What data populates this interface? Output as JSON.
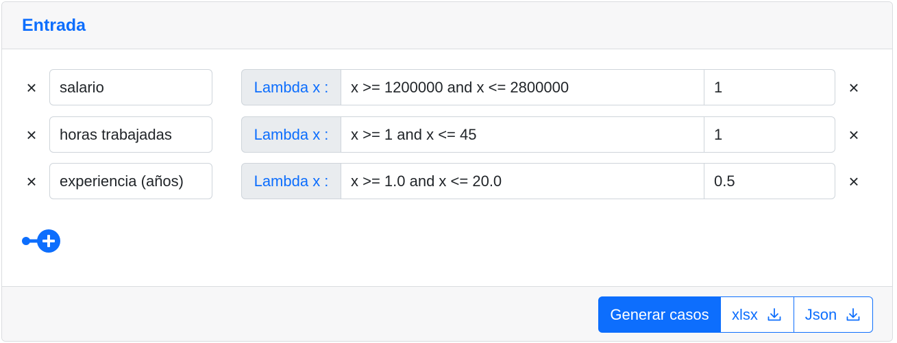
{
  "header": {
    "title": "Entrada"
  },
  "variables": [
    {
      "name": "salario",
      "prefix": "Lambda x :",
      "expression": "x >= 1200000 and x <= 2800000",
      "step": "1"
    },
    {
      "name": "horas trabajadas",
      "prefix": "Lambda x :",
      "expression": "x >= 1 and x <= 45",
      "step": "1"
    },
    {
      "name": "experiencia (años)",
      "prefix": "Lambda x :",
      "expression": "x >= 1.0 and x <= 20.0",
      "step": "0.5"
    }
  ],
  "icons": {
    "remove": "close-icon",
    "add": "add-circle-icon",
    "download": "download-icon"
  },
  "remove_glyph": "×",
  "footer": {
    "generate_label": "Generar casos",
    "xlsx_label": "xlsx",
    "json_label": "Json"
  },
  "colors": {
    "accent": "#0d6efd",
    "prefix_bg": "#e9ecef",
    "header_bg": "#f7f7f8"
  }
}
